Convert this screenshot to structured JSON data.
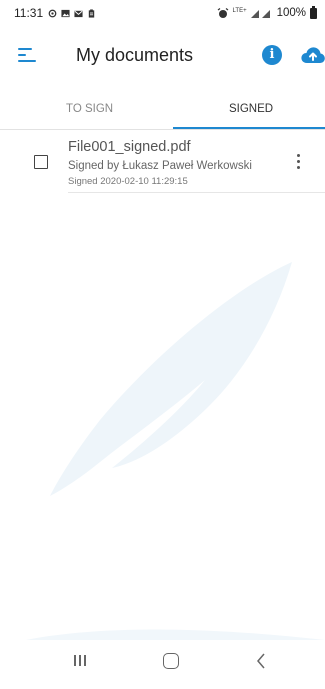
{
  "status_bar": {
    "time": "11:31",
    "network": "LTE+",
    "battery": "100%"
  },
  "header": {
    "title": "My documents"
  },
  "tabs": [
    {
      "label": "TO SIGN",
      "active": false
    },
    {
      "label": "SIGNED",
      "active": true
    }
  ],
  "documents": [
    {
      "name": "File001_signed.pdf",
      "signer": "Signed by Łukasz Paweł Werkowski",
      "date": "Signed 2020-02-10 11:29:15"
    }
  ],
  "icons": {
    "menu": "hamburger-menu-icon",
    "info": "info-icon",
    "upload": "cloud-upload-icon",
    "more": "more-vert-icon"
  },
  "colors": {
    "accent": "#1e88d0",
    "watermark": "#eef5fa"
  }
}
